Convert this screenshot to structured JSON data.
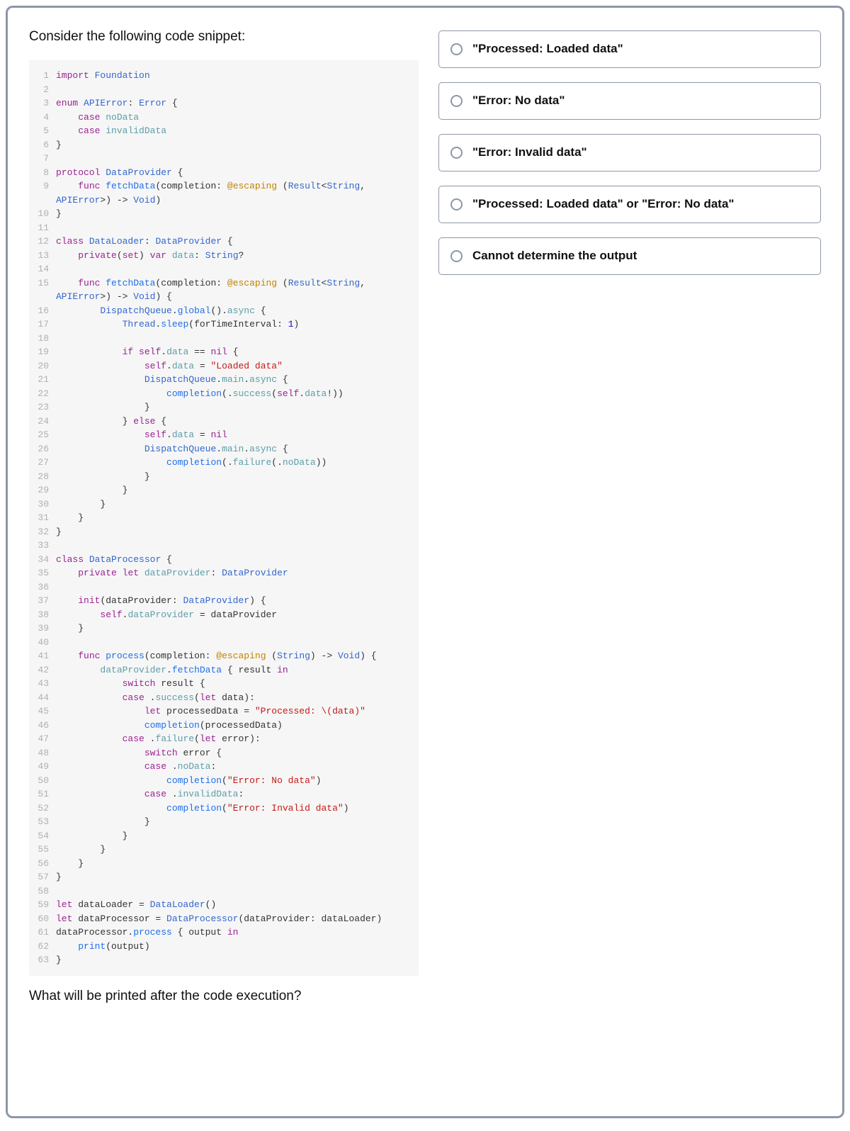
{
  "question": {
    "intro": "Consider the following code snippet:",
    "followup": "What will be printed after the code execution?"
  },
  "code": [
    {
      "n": 1,
      "html": "<span class='kw'>import</span> <span class='type'>Foundation</span>"
    },
    {
      "n": 2,
      "html": ""
    },
    {
      "n": 3,
      "html": "<span class='kw'>enum</span> <span class='type'>APIError</span>: <span class='type'>Error</span> {"
    },
    {
      "n": 4,
      "html": "    <span class='kw'>case</span> <span class='prop'>noData</span>"
    },
    {
      "n": 5,
      "html": "    <span class='kw'>case</span> <span class='prop'>invalidData</span>"
    },
    {
      "n": 6,
      "html": "}"
    },
    {
      "n": 7,
      "html": ""
    },
    {
      "n": 8,
      "html": "<span class='kw'>protocol</span> <span class='type'>DataProvider</span> {"
    },
    {
      "n": 9,
      "html": "    <span class='kw'>func</span> <span class='fn'>fetchData</span>(completion: <span class='attr'>@escaping</span> (<span class='type'>Result</span>&lt;<span class='type'>String</span>, <span class='type'>APIError</span>&gt;) -&gt; <span class='type'>Void</span>)"
    },
    {
      "n": 10,
      "html": "}"
    },
    {
      "n": 11,
      "html": ""
    },
    {
      "n": 12,
      "html": "<span class='kw'>class</span> <span class='type'>DataLoader</span>: <span class='type'>DataProvider</span> {"
    },
    {
      "n": 13,
      "html": "    <span class='kw'>private</span>(<span class='kw'>set</span>) <span class='kw'>var</span> <span class='prop'>data</span>: <span class='type'>String</span>?"
    },
    {
      "n": 14,
      "html": ""
    },
    {
      "n": 15,
      "html": "    <span class='kw'>func</span> <span class='fn'>fetchData</span>(completion: <span class='attr'>@escaping</span> (<span class='type'>Result</span>&lt;<span class='type'>String</span>, <span class='type'>APIError</span>&gt;) -&gt; <span class='type'>Void</span>) {"
    },
    {
      "n": 16,
      "html": "        <span class='type'>DispatchQueue</span>.<span class='fn'>global</span>().<span class='prop'>async</span> {"
    },
    {
      "n": 17,
      "html": "            <span class='type'>Thread</span>.<span class='fn'>sleep</span>(forTimeInterval: <span class='num'>1</span>)"
    },
    {
      "n": 18,
      "html": ""
    },
    {
      "n": 19,
      "html": "            <span class='kw'>if</span> <span class='kw'>self</span>.<span class='prop'>data</span> == <span class='kw'>nil</span> {"
    },
    {
      "n": 20,
      "html": "                <span class='kw'>self</span>.<span class='prop'>data</span> = <span class='str'>\"Loaded data\"</span>"
    },
    {
      "n": 21,
      "html": "                <span class='type'>DispatchQueue</span>.<span class='prop'>main</span>.<span class='prop'>async</span> {"
    },
    {
      "n": 22,
      "html": "                    <span class='fn'>completion</span>(.<span class='prop'>success</span>(<span class='kw'>self</span>.<span class='prop'>data</span>!))"
    },
    {
      "n": 23,
      "html": "                }"
    },
    {
      "n": 24,
      "html": "            } <span class='kw'>else</span> {"
    },
    {
      "n": 25,
      "html": "                <span class='kw'>self</span>.<span class='prop'>data</span> = <span class='kw'>nil</span>"
    },
    {
      "n": 26,
      "html": "                <span class='type'>DispatchQueue</span>.<span class='prop'>main</span>.<span class='prop'>async</span> {"
    },
    {
      "n": 27,
      "html": "                    <span class='fn'>completion</span>(.<span class='prop'>failure</span>(.<span class='prop'>noData</span>))"
    },
    {
      "n": 28,
      "html": "                }"
    },
    {
      "n": 29,
      "html": "            }"
    },
    {
      "n": 30,
      "html": "        }"
    },
    {
      "n": 31,
      "html": "    }"
    },
    {
      "n": 32,
      "html": "}"
    },
    {
      "n": 33,
      "html": ""
    },
    {
      "n": 34,
      "html": "<span class='kw'>class</span> <span class='type'>DataProcessor</span> {"
    },
    {
      "n": 35,
      "html": "    <span class='kw'>private</span> <span class='kw'>let</span> <span class='prop'>dataProvider</span>: <span class='type'>DataProvider</span>"
    },
    {
      "n": 36,
      "html": ""
    },
    {
      "n": 37,
      "html": "    <span class='kw'>init</span>(dataProvider: <span class='type'>DataProvider</span>) {"
    },
    {
      "n": 38,
      "html": "        <span class='kw'>self</span>.<span class='prop'>dataProvider</span> = dataProvider"
    },
    {
      "n": 39,
      "html": "    }"
    },
    {
      "n": 40,
      "html": ""
    },
    {
      "n": 41,
      "html": "    <span class='kw'>func</span> <span class='fn'>process</span>(completion: <span class='attr'>@escaping</span> (<span class='type'>String</span>) -&gt; <span class='type'>Void</span>) {"
    },
    {
      "n": 42,
      "html": "        <span class='prop'>dataProvider</span>.<span class='fn'>fetchData</span> { result <span class='kw'>in</span>"
    },
    {
      "n": 43,
      "html": "            <span class='kw'>switch</span> result {"
    },
    {
      "n": 44,
      "html": "            <span class='kw'>case</span> .<span class='prop'>success</span>(<span class='kw'>let</span> data):"
    },
    {
      "n": 45,
      "html": "                <span class='kw'>let</span> processedData = <span class='str'>\"Processed: \\(data)\"</span>"
    },
    {
      "n": 46,
      "html": "                <span class='fn'>completion</span>(processedData)"
    },
    {
      "n": 47,
      "html": "            <span class='kw'>case</span> .<span class='prop'>failure</span>(<span class='kw'>let</span> error):"
    },
    {
      "n": 48,
      "html": "                <span class='kw'>switch</span> error {"
    },
    {
      "n": 49,
      "html": "                <span class='kw'>case</span> .<span class='prop'>noData</span>:"
    },
    {
      "n": 50,
      "html": "                    <span class='fn'>completion</span>(<span class='str'>\"Error: No data\"</span>)"
    },
    {
      "n": 51,
      "html": "                <span class='kw'>case</span> .<span class='prop'>invalidData</span>:"
    },
    {
      "n": 52,
      "html": "                    <span class='fn'>completion</span>(<span class='str'>\"Error: Invalid data\"</span>)"
    },
    {
      "n": 53,
      "html": "                }"
    },
    {
      "n": 54,
      "html": "            }"
    },
    {
      "n": 55,
      "html": "        }"
    },
    {
      "n": 56,
      "html": "    }"
    },
    {
      "n": 57,
      "html": "}"
    },
    {
      "n": 58,
      "html": ""
    },
    {
      "n": 59,
      "html": "<span class='kw'>let</span> dataLoader = <span class='type'>DataLoader</span>()"
    },
    {
      "n": 60,
      "html": "<span class='kw'>let</span> dataProcessor = <span class='type'>DataProcessor</span>(dataProvider: dataLoader)"
    },
    {
      "n": 61,
      "html": "dataProcessor.<span class='fn'>process</span> { output <span class='kw'>in</span>"
    },
    {
      "n": 62,
      "html": "    <span class='fn'>print</span>(output)"
    },
    {
      "n": 63,
      "html": "}"
    }
  ],
  "answers": [
    {
      "text": "\"Processed: Loaded data\""
    },
    {
      "text": "\"Error: No data\""
    },
    {
      "text": "\"Error: Invalid data\""
    },
    {
      "text": "\"Processed: Loaded data\" or \"Error: No data\""
    },
    {
      "text": "Cannot determine the output"
    }
  ]
}
